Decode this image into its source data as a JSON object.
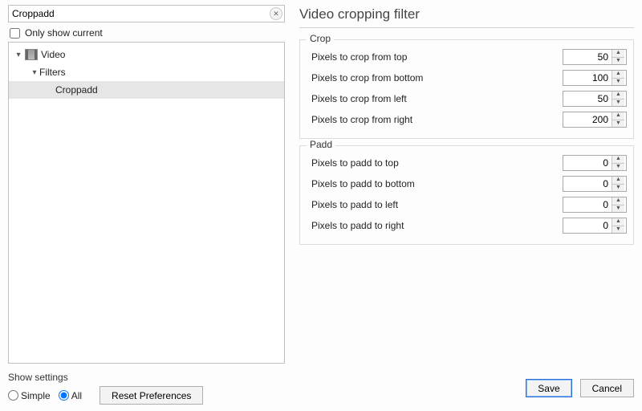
{
  "left": {
    "search_value": "Croppadd",
    "only_show_current_label": "Only show current",
    "only_show_current_checked": false,
    "tree": {
      "video_label": "Video",
      "filters_label": "Filters",
      "item_label": "Croppadd"
    }
  },
  "right": {
    "title": "Video cropping filter",
    "crop": {
      "title": "Crop",
      "fields": [
        {
          "label": "Pixels to crop from top",
          "value": 50
        },
        {
          "label": "Pixels to crop from bottom",
          "value": 100
        },
        {
          "label": "Pixels to crop from left",
          "value": 50
        },
        {
          "label": "Pixels to crop from right",
          "value": 200
        }
      ]
    },
    "padd": {
      "title": "Padd",
      "fields": [
        {
          "label": "Pixels to padd to top",
          "value": 0
        },
        {
          "label": "Pixels to padd to bottom",
          "value": 0
        },
        {
          "label": "Pixels to padd to left",
          "value": 0
        },
        {
          "label": "Pixels to padd to right",
          "value": 0
        }
      ]
    }
  },
  "footer": {
    "show_settings_label": "Show settings",
    "simple_label": "Simple",
    "all_label": "All",
    "selected_mode": "all",
    "reset_label": "Reset Preferences",
    "save_label": "Save",
    "cancel_label": "Cancel"
  }
}
